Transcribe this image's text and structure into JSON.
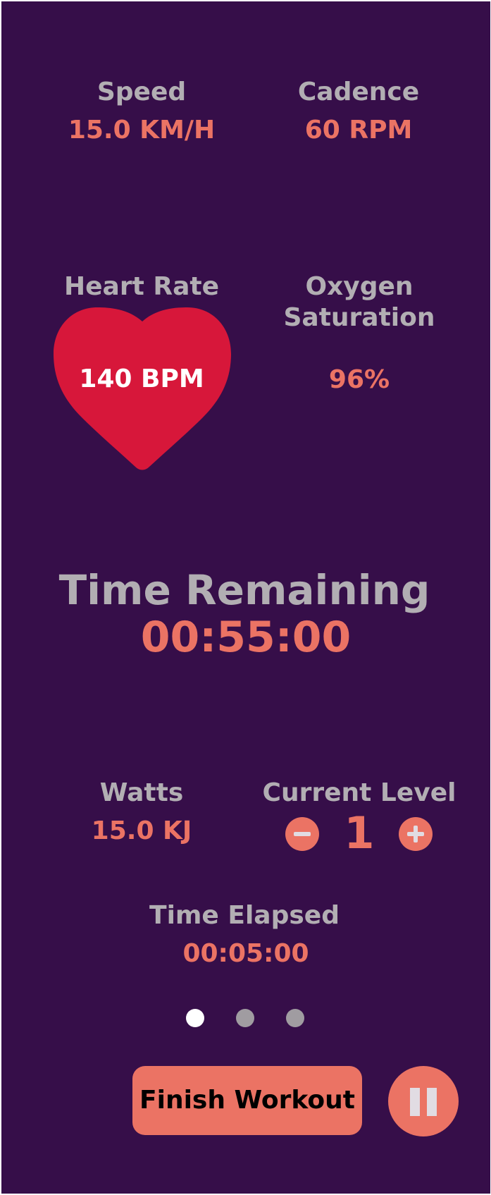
{
  "stats": {
    "speed": {
      "label": "Speed",
      "value": "15.0 KM/H"
    },
    "cadence": {
      "label": "Cadence",
      "value": "60 RPM"
    },
    "heart_rate": {
      "label": "Heart Rate",
      "value": "140 BPM"
    },
    "oxygen": {
      "label_line1": "Oxygen",
      "label_line2": "Saturation",
      "value": "96%"
    },
    "time_remaining": {
      "label": "Time Remaining",
      "value": "00:55:00"
    },
    "watts": {
      "label": "Watts",
      "value": "15.0 KJ"
    },
    "level": {
      "label": "Current Level",
      "value": "1"
    },
    "time_elapsed": {
      "label": "Time Elapsed",
      "value": "00:05:00"
    }
  },
  "pager": {
    "count": 3,
    "active_index": 0
  },
  "actions": {
    "finish_label": "Finish Workout"
  },
  "icons": {
    "heart": "heart-icon",
    "decrease": "minus-icon",
    "increase": "plus-icon",
    "pause": "pause-icon"
  },
  "colors": {
    "background": "#360e49",
    "accent": "#eb7364",
    "label": "#b2aeb3",
    "heart": "#d7173a",
    "dot_active": "#ffffff",
    "dot_inactive": "#a09ca1"
  }
}
